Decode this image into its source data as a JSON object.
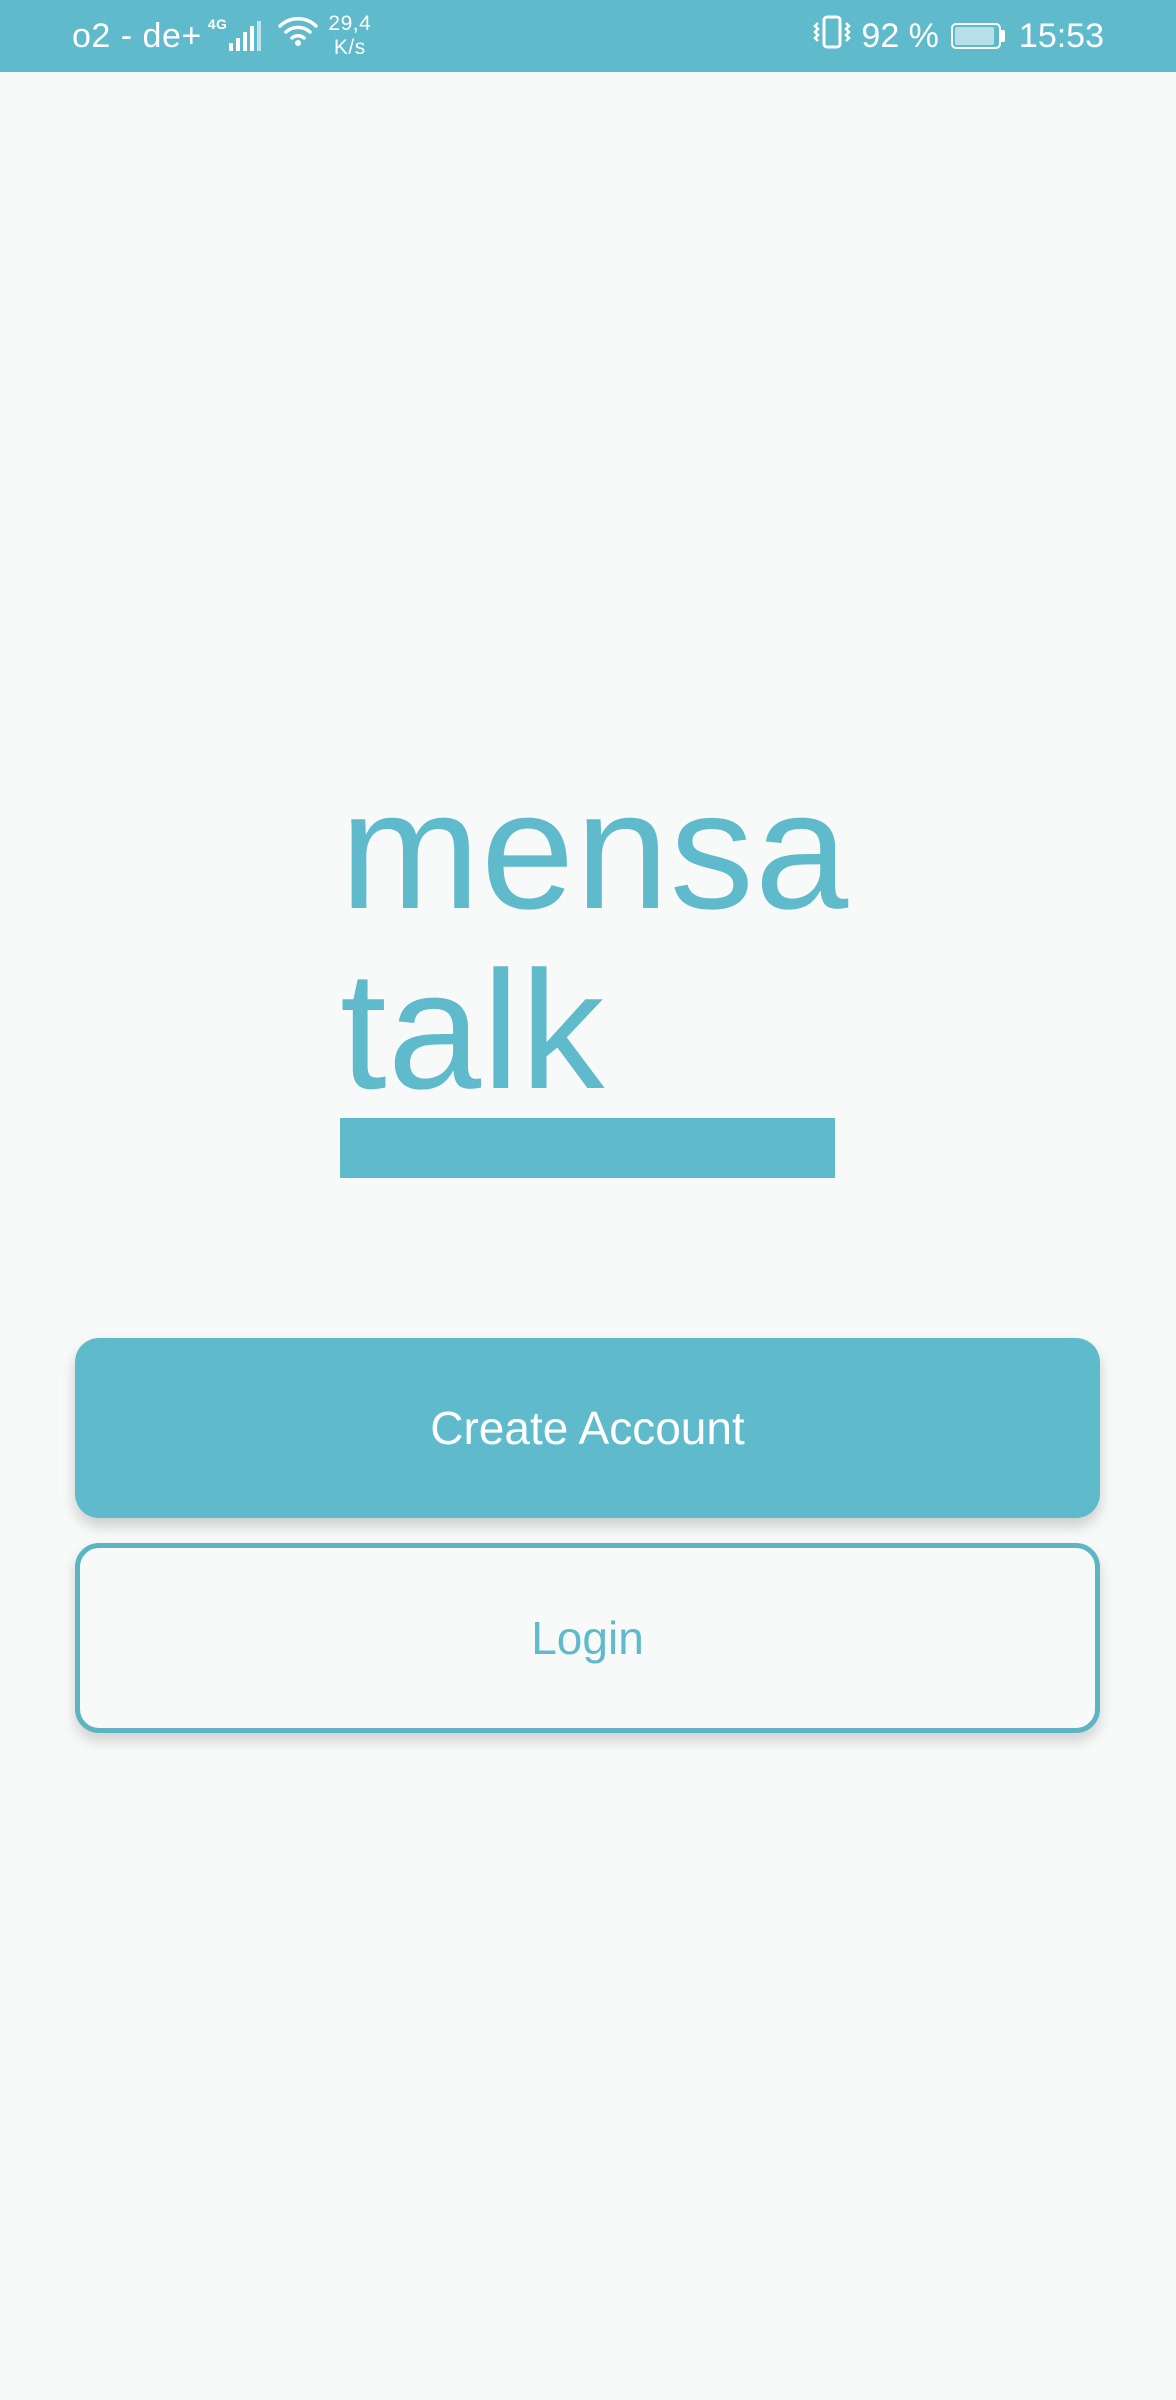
{
  "status_bar": {
    "carrier": "o2 - de+",
    "network_type": "4G",
    "net_speed_value": "29,4",
    "net_speed_unit": "K/s",
    "battery_percent": "92 %",
    "time": "15:53",
    "icons": [
      "signal-icon",
      "wifi-icon",
      "vibrate-icon",
      "battery-icon"
    ]
  },
  "logo": {
    "line1": "mensa",
    "line2": "talk"
  },
  "actions": {
    "create_account_label": "Create Account",
    "login_label": "Login"
  },
  "colors": {
    "accent": "#5fbacc",
    "background": "#f8fafa",
    "on_accent": "#ffffff"
  }
}
